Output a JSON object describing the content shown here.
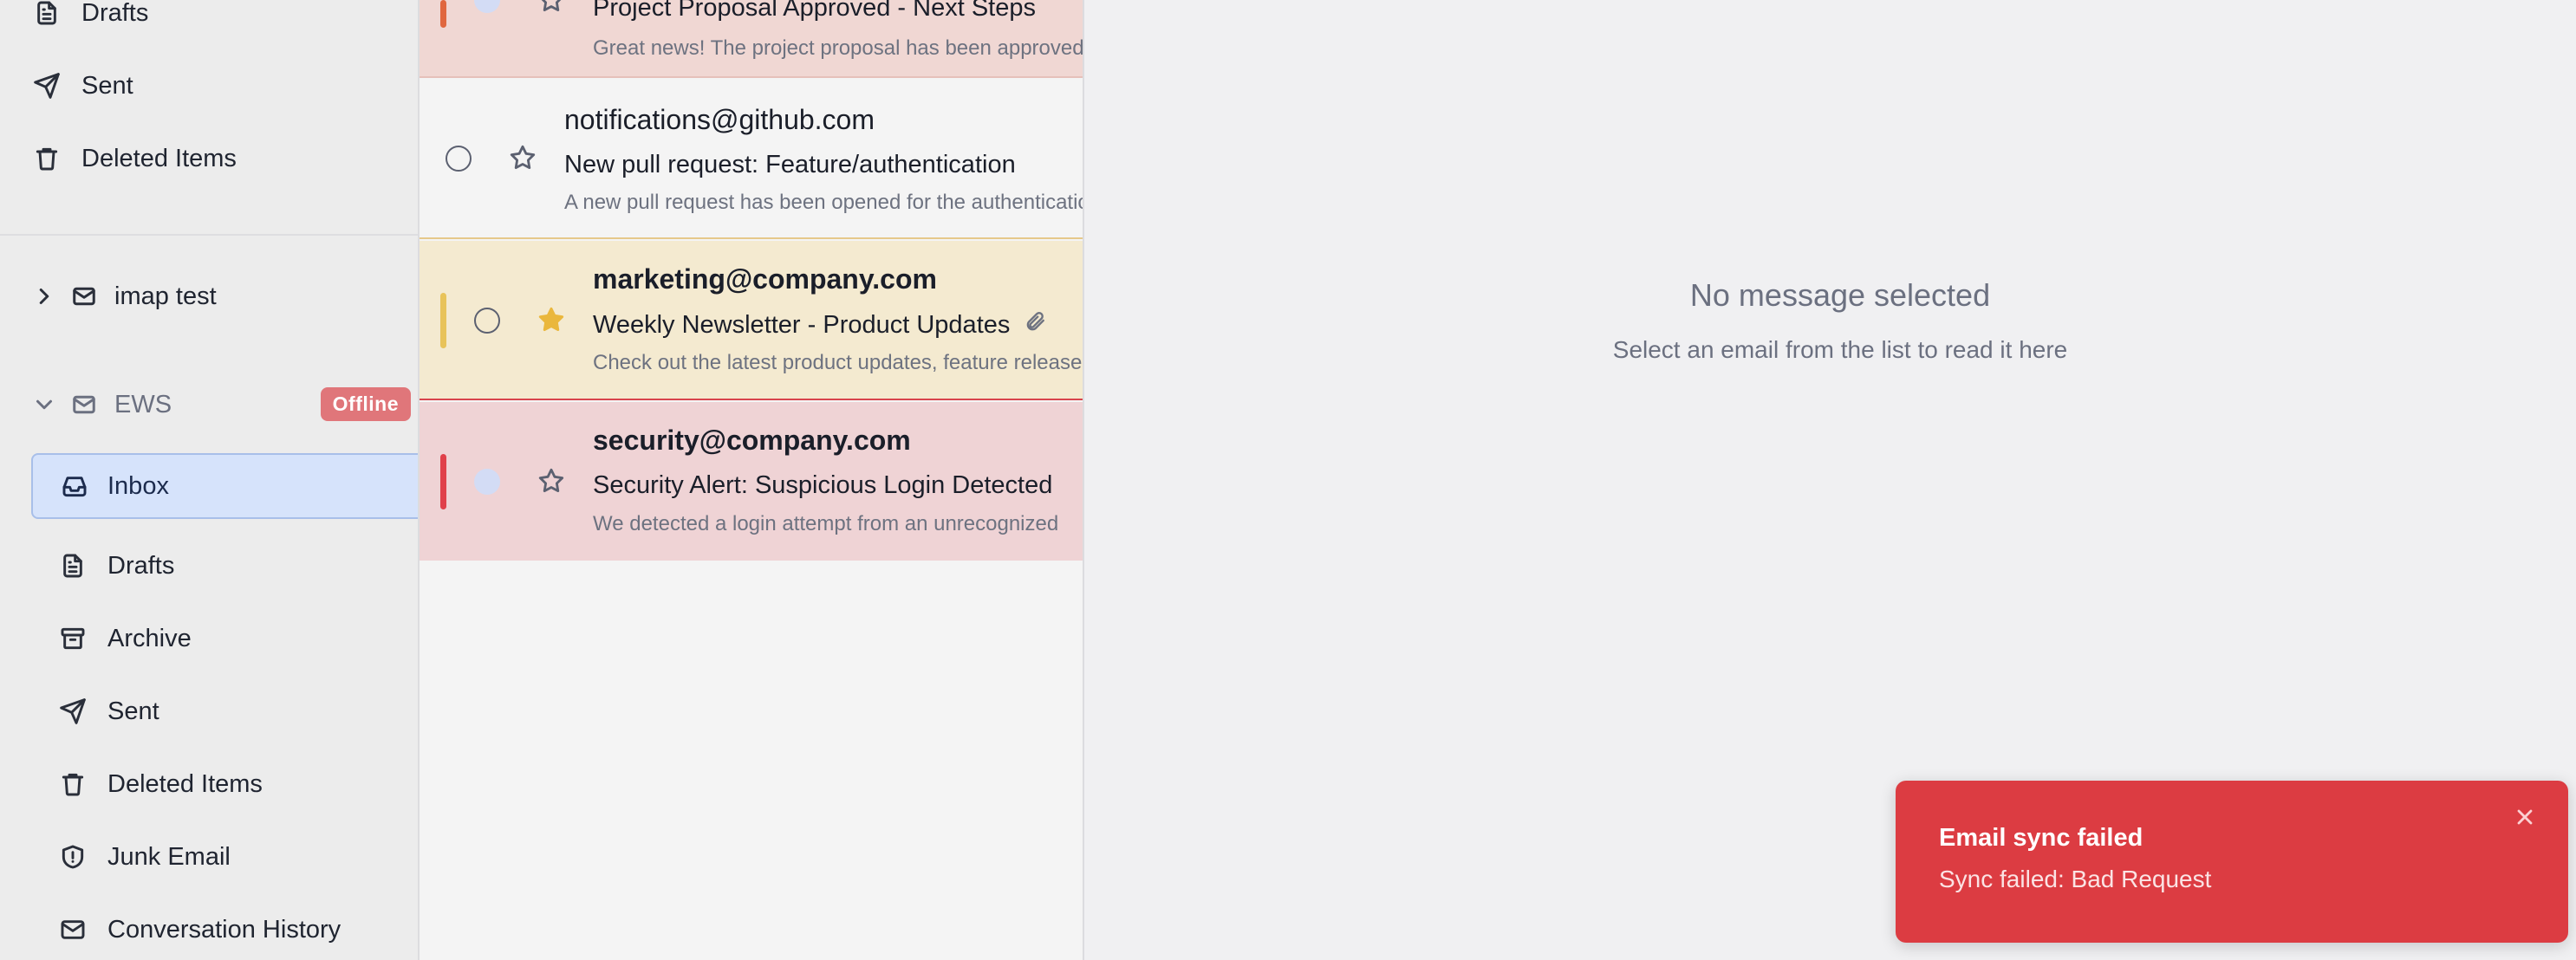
{
  "sidebar": {
    "top_items": [
      {
        "label": "Drafts",
        "icon": "file-text-icon"
      },
      {
        "label": "Sent",
        "icon": "send-icon"
      },
      {
        "label": "Deleted Items",
        "icon": "trash-icon"
      }
    ],
    "accounts": [
      {
        "name": "imap test",
        "expanded": false
      },
      {
        "name": "EWS",
        "expanded": true,
        "status_badge": "Offline"
      }
    ],
    "ews_items": [
      {
        "label": "Inbox",
        "icon": "inbox-icon",
        "active": true
      },
      {
        "label": "Drafts",
        "icon": "file-text-icon"
      },
      {
        "label": "Archive",
        "icon": "archive-icon"
      },
      {
        "label": "Sent",
        "icon": "send-icon"
      },
      {
        "label": "Deleted Items",
        "icon": "trash-icon"
      },
      {
        "label": "Junk Email",
        "icon": "shield-alert-icon"
      },
      {
        "label": "Conversation History",
        "icon": "mail-icon"
      }
    ]
  },
  "messages": [
    {
      "from": "",
      "subject": "Project Proposal Approved - Next Steps",
      "preview": "Great news! The project proposal has been approved",
      "priority_color": "#e0673f",
      "row_bg": "#f0d7d3",
      "unread": true,
      "starred": false
    },
    {
      "from": "notifications@github.com",
      "subject": "New pull request: Feature/authentication",
      "preview": "A new pull request has been opened for the authentication",
      "priority_color": "",
      "row_bg": "#f4f4f4",
      "unread": false,
      "starred": false
    },
    {
      "from": "marketing@company.com",
      "subject": "Weekly Newsletter - Product Updates",
      "preview": "Check out the latest product updates, feature releases",
      "priority_color": "#e8c35a",
      "row_bg": "#f4ead0",
      "unread": false,
      "starred": true,
      "has_attachment": true
    },
    {
      "from": "security@company.com",
      "subject": "Security Alert: Suspicious Login Detected",
      "preview": "We detected a login attempt from an unrecognized",
      "priority_color": "#e0404a",
      "row_bg": "#efd3d5",
      "unread": true,
      "starred": false
    }
  ],
  "reader": {
    "empty_title": "No message selected",
    "empty_subtitle": "Select an email from the list to read it here"
  },
  "toast": {
    "title": "Email sync failed",
    "message": "Sync failed: Bad Request",
    "background": "#dc3c42"
  }
}
